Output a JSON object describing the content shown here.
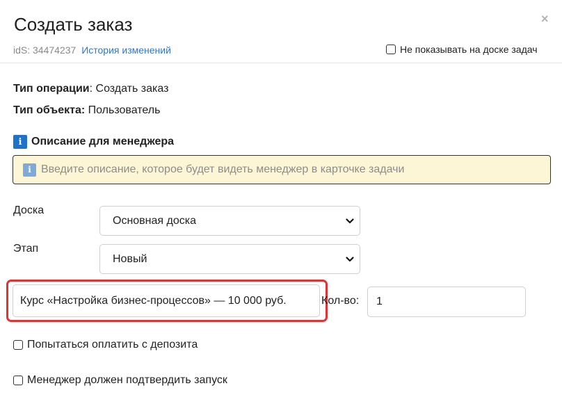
{
  "header": {
    "title": "Создать заказ",
    "close_symbol": "×",
    "ids_text": "idS: 34474237",
    "history_link": "История изменений",
    "hide_board_label": "Не показывать на доске задач"
  },
  "info": {
    "operation_label": "Тип операции",
    "operation_value": ": Создать заказ",
    "object_label": "Тип объекта:",
    "object_value": " Пользователь"
  },
  "description": {
    "title": "Описание для менеджера",
    "badge": "i",
    "placeholder": "Введите описание, которое будет видеть менеджер в карточке задачи"
  },
  "board": {
    "label": "Доска",
    "selected": "Основная доска"
  },
  "stage": {
    "label": "Этап",
    "selected": "Новый"
  },
  "product": {
    "value": "Курс «Настройка бизнес-процессов» — 10 000 руб.",
    "qty_label": "Кол-во:",
    "qty_value": "1",
    "highlight_color": "#e03333"
  },
  "options": {
    "deposit_label": "Попытаться оплатить с депозита",
    "confirm_label": "Менеджер должен подтвердить запуск"
  },
  "icons": {
    "close": "close-icon",
    "info": "info-icon",
    "chevron": "chevron-down-icon"
  }
}
